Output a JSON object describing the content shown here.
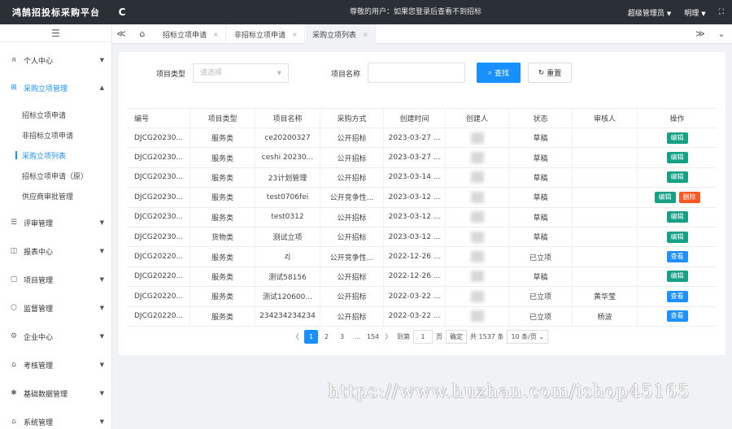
{
  "header": {
    "brand": "鸿鹄招投标采购平台",
    "refresh_icon": "C",
    "notice": "尊敬的用户：如果您登录后查看不到招标",
    "role": "超级管理员",
    "user": "明理",
    "expand_icon": "⛶"
  },
  "sidebar": {
    "toggle_icon": "☰",
    "items": [
      {
        "label": "个人中心",
        "icon": "user-icon",
        "glyph": "ᴙ",
        "arrow": "▼"
      },
      {
        "label": "采购立项管理",
        "icon": "grid-icon",
        "glyph": "⊞",
        "arrow": "▲"
      },
      {
        "label": "评审管理",
        "icon": "list-icon",
        "glyph": "☰",
        "arrow": "▼"
      },
      {
        "label": "报表中心",
        "icon": "book-icon",
        "glyph": "◫",
        "arrow": "▼"
      },
      {
        "label": "项目管理",
        "icon": "folder-icon",
        "glyph": "▢",
        "arrow": "▼"
      },
      {
        "label": "监督管理",
        "icon": "hexagon-icon",
        "glyph": "⬡",
        "arrow": "▼"
      },
      {
        "label": "企业中心",
        "icon": "gear-icon",
        "glyph": "⚙",
        "arrow": "▼"
      },
      {
        "label": "考核管理",
        "icon": "home-icon",
        "glyph": "⌂",
        "arrow": "▼"
      },
      {
        "label": "基础数据管理",
        "icon": "cog-icon",
        "glyph": "✱",
        "arrow": "▼"
      },
      {
        "label": "系统管理",
        "icon": "house-icon",
        "glyph": "⌂",
        "arrow": "▼"
      }
    ],
    "sub_items": [
      "招标立项申请",
      "非招标立项申请",
      "采购立项列表",
      "招标立项申请（原）",
      "供应商审批管理"
    ]
  },
  "tabs": {
    "prev_icon": "≪",
    "home_icon": "⌂",
    "items": [
      "招标立项申请",
      "非招标立项申请",
      "采购立项列表"
    ],
    "close_icon": "×",
    "next_icon": "≫",
    "down_icon": "⌄"
  },
  "search": {
    "type_label": "项目类型",
    "type_placeholder": "请选择",
    "name_label": "项目名称",
    "name_value": "",
    "search_label": "查找",
    "reset_label": "重置",
    "search_icon": "⌕",
    "reset_icon": "↻"
  },
  "table": {
    "columns": [
      "编号",
      "项目类型",
      "项目名称",
      "采购方式",
      "创建时间",
      "创建人",
      "状态",
      "审核人",
      "操作"
    ],
    "rows": [
      {
        "id": "DJCG20230...",
        "type": "服务类",
        "name": "ce20200327",
        "method": "公开招标",
        "time": "2023-03-27 ...",
        "creator": "",
        "status": "草稿",
        "reviewer": "",
        "ops": [
          "编辑"
        ]
      },
      {
        "id": "DJCG20230...",
        "type": "服务类",
        "name": "ceshi 20230...",
        "method": "公开招标",
        "time": "2023-03-27 ...",
        "creator": "",
        "status": "草稿",
        "reviewer": "",
        "ops": [
          "编辑"
        ]
      },
      {
        "id": "DJCG20230...",
        "type": "服务类",
        "name": "23计划管理",
        "method": "公开招标",
        "time": "2023-03-14 ...",
        "creator": "",
        "status": "草稿",
        "reviewer": "",
        "ops": [
          "编辑"
        ]
      },
      {
        "id": "DJCG20230...",
        "type": "服务类",
        "name": "test0706fei",
        "method": "公开竞争性...",
        "time": "2023-03-12 ...",
        "creator": "",
        "status": "草稿",
        "reviewer": "",
        "ops": [
          "编辑",
          "删除"
        ]
      },
      {
        "id": "DJCG20230...",
        "type": "服务类",
        "name": "test0312",
        "method": "公开招标",
        "time": "2023-03-12 ...",
        "creator": "",
        "status": "草稿",
        "reviewer": "",
        "ops": [
          "编辑"
        ]
      },
      {
        "id": "DJCG20230...",
        "type": "货物类",
        "name": "测试立项",
        "method": "公开招标",
        "time": "2023-03-12 ...",
        "creator": "",
        "status": "草稿",
        "reviewer": "",
        "ops": [
          "编辑"
        ]
      },
      {
        "id": "DJCG20220...",
        "type": "服务类",
        "name": "zj",
        "method": "公开竞争性...",
        "time": "2022-12-26 ...",
        "creator": "",
        "status": "已立项",
        "reviewer": "",
        "ops": [
          "查看"
        ]
      },
      {
        "id": "DJCG20220...",
        "type": "服务类",
        "name": "测试58156",
        "method": "公开招标",
        "time": "2022-12-26 ...",
        "creator": "",
        "status": "草稿",
        "reviewer": "",
        "ops": [
          "编辑"
        ]
      },
      {
        "id": "DJCG20220...",
        "type": "服务类",
        "name": "测试120600...",
        "method": "公开招标",
        "time": "2022-03-22 ...",
        "creator": "",
        "status": "已立项",
        "reviewer": "黄华莹",
        "ops": [
          "查看"
        ]
      },
      {
        "id": "DJCG20220...",
        "type": "服务类",
        "name": "234234234234",
        "method": "公开招标",
        "time": "2022-03-22 ...",
        "creator": "",
        "status": "已立项",
        "reviewer": "杨波",
        "ops": [
          "查看"
        ]
      }
    ]
  },
  "pagination": {
    "prev": "〈",
    "pages": [
      "1",
      "2",
      "3",
      "...",
      "154"
    ],
    "next": "〉",
    "goto_label": "到第",
    "goto_value": "1",
    "page_unit": "页",
    "confirm": "确定",
    "total": "共 1537 条",
    "page_size": "10 条/页"
  },
  "watermark": "https://www.huzhan.com/ishop45165",
  "colors": {
    "topbar": "#2b2f36",
    "primary": "#1890ff",
    "edit": "#16a085",
    "delete": "#ff5722"
  }
}
